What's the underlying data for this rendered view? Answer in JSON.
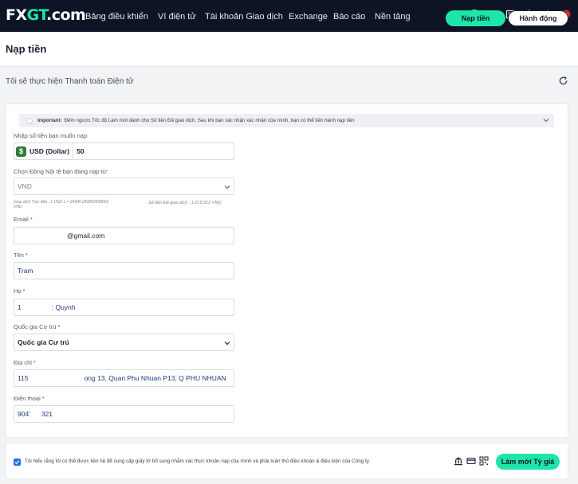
{
  "nav": {
    "logo_a": "FX",
    "logo_b": "GT",
    "logo_c": ".com",
    "items": [
      "Bảng điều khiển",
      "Ví điện tử",
      "Tài khoản Giao dịch",
      "Exchange",
      "Báo cáo",
      "Nền tảng"
    ],
    "icons": [
      "verified-check-icon",
      "mail-icon",
      "inbox-icon",
      "gear-icon",
      "power-icon",
      "vietnam-flag-icon"
    ],
    "accent": "#1de6a8"
  },
  "header": {
    "title": "Nạp tiền",
    "deposit_label": "Nạp tiền",
    "action_label": "Hành động"
  },
  "subtitle": "Tôi sẽ thực hiện Thanh toán Điện tử",
  "important": {
    "label": "Important:",
    "text": "Đếm ngược Tốc độ Làm mới dành cho Số tiền Đã giao dịch. Sau khi bạn xác nhận xác nhận của mình, bạn có thể tiến hành nạp tiền"
  },
  "form": {
    "amount_label": "Nhập số tiền bạn muốn nạp",
    "currency": "USD (Dollar)",
    "amount_value": "50",
    "local_currency_label": "Chọn Đồng Nội tệ bạn đang nạp từ:",
    "local_currency_value": "VND",
    "rate_note_a": "Giao dịch Trực tiếp : 1 USD 1 = 24390.243902439001",
    "rate_note_b": "VND",
    "traded_amount": "Số tiền Đã giao dịch : 1,219,512 VND",
    "email_label": "Email *",
    "email_value": "@gmail.com",
    "first_name_label": "Tên *",
    "first_name_value": "Tram",
    "last_name_label": "Họ *",
    "last_name_value_a": "1",
    "last_name_value_b": ": Quynh",
    "country_label": "Quốc gia Cư trú *",
    "country_value": "Quốc gia Cư trú",
    "address_label": "Địa chỉ *",
    "address_value_a": "115",
    "address_value_b": "ong 13, Quan Phu Nhuan P13, Q PHU NHUAN",
    "phone_label": "Điện thoại *",
    "phone_value_a": "904'",
    "phone_value_b": "321"
  },
  "footer": {
    "consent": "Tôi hiểu rằng tôi có thể được liên hệ để cung cấp giấy tờ bổ sung nhằm xác thực khoản nạp của mình và phải tuân thủ điều khoản & điều kiện của Công ty.",
    "icons": [
      "bank-icon",
      "card-icon",
      "qr-code-icon"
    ],
    "refresh_rate_label": "Làm mới Tỷ giá"
  }
}
